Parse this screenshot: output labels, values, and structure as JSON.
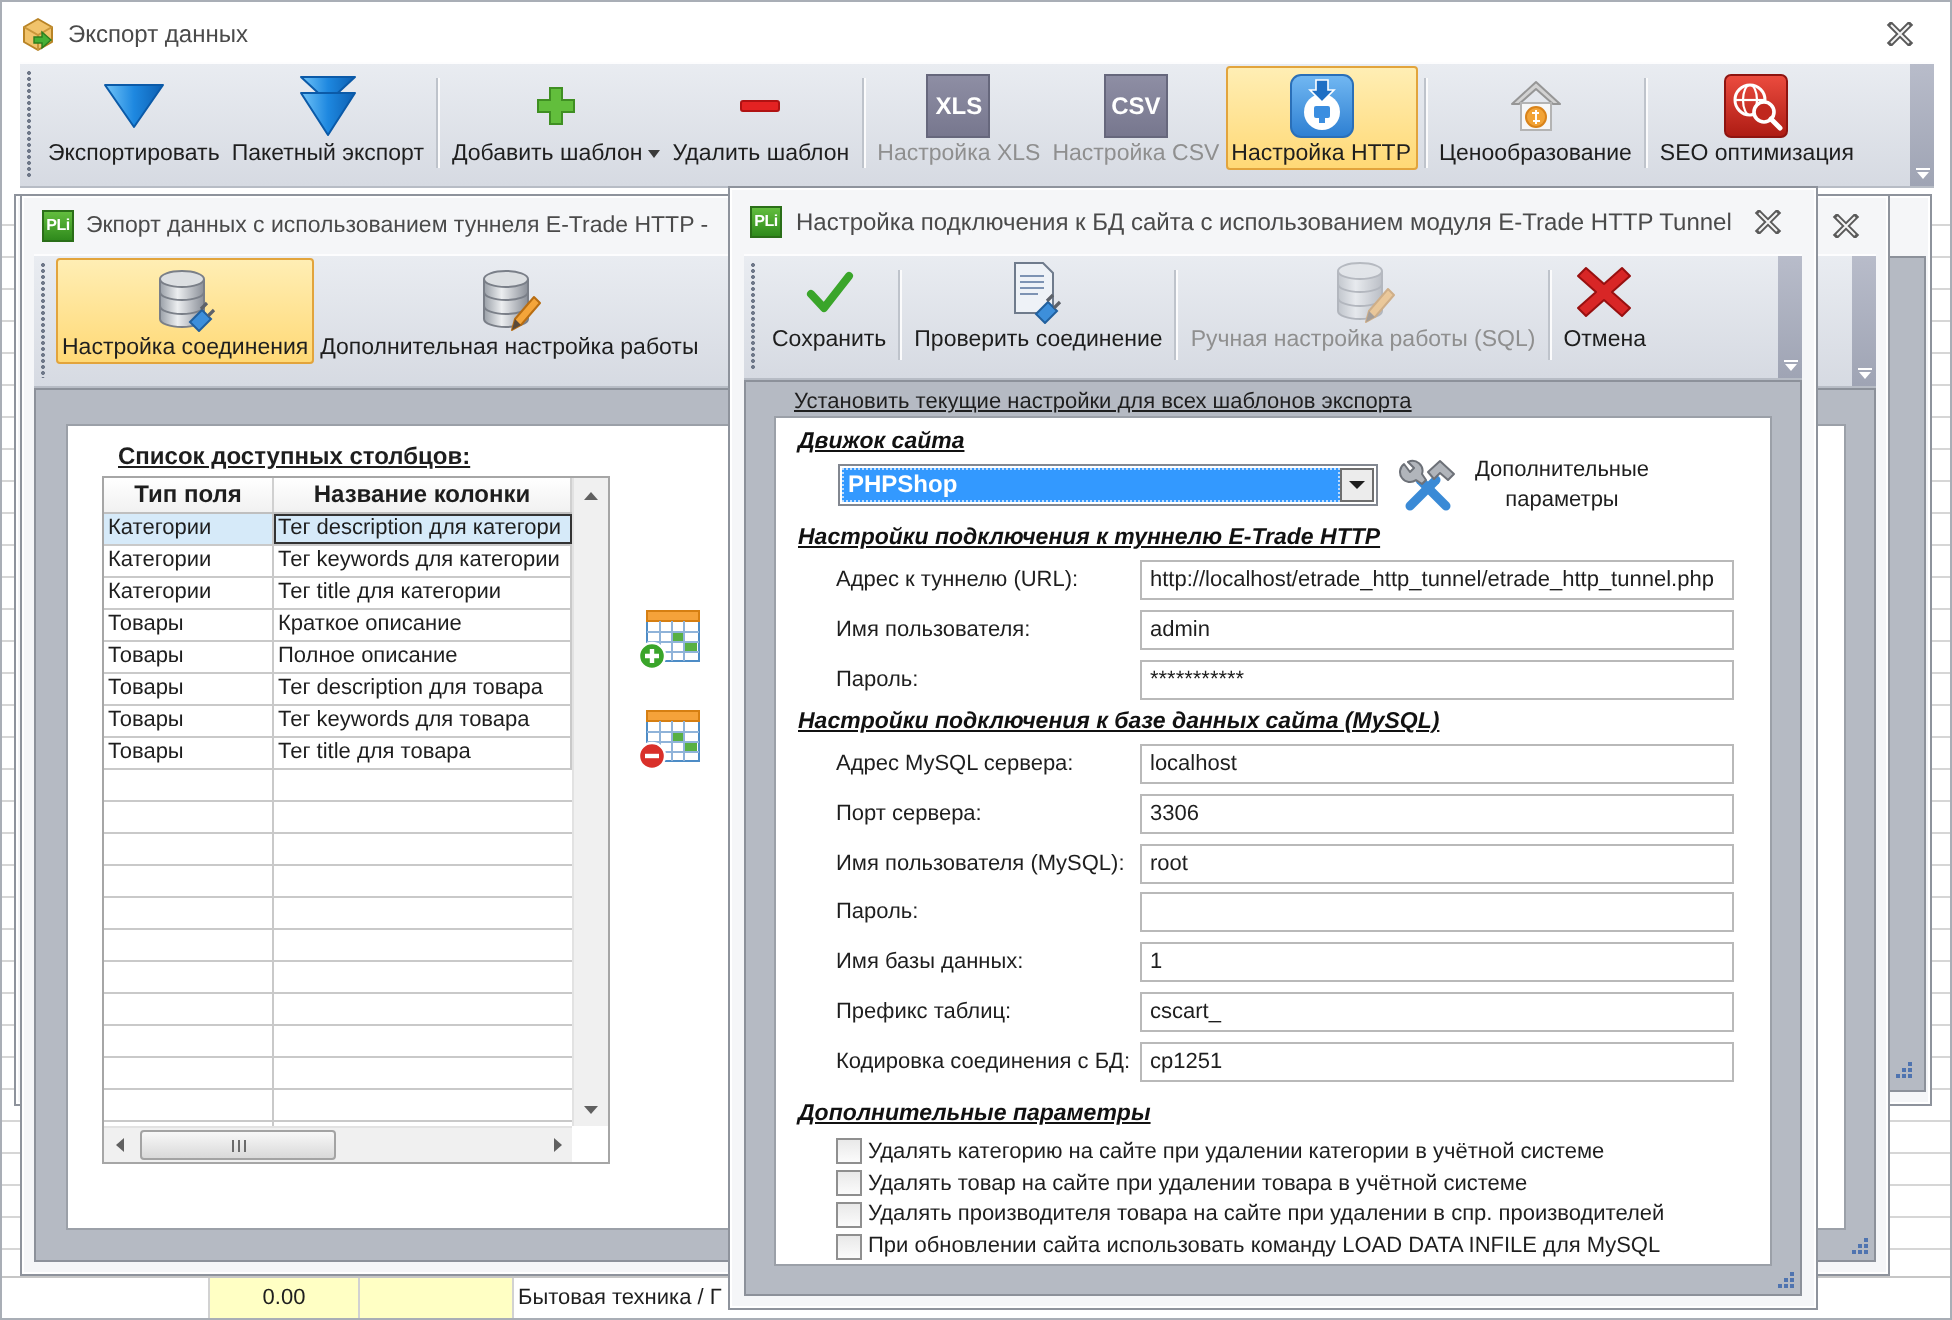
{
  "window": {
    "title": "Экспорт данных"
  },
  "toolbar": {
    "groups": [
      [
        {
          "label": "Экспортировать",
          "selected": false,
          "disabled": false,
          "dropdown": false
        },
        {
          "label": "Пакетный экспорт",
          "selected": false,
          "disabled": false,
          "dropdown": false
        }
      ],
      [
        {
          "label": "Добавить шаблон",
          "selected": false,
          "disabled": false,
          "dropdown": true
        },
        {
          "label": "Удалить шаблон",
          "selected": false,
          "disabled": false,
          "dropdown": false
        }
      ],
      [
        {
          "label": "Настройка XLS",
          "icon_text": "XLS",
          "selected": false,
          "disabled": true,
          "dropdown": false
        },
        {
          "label": "Настройка CSV",
          "icon_text": "CSV",
          "selected": false,
          "disabled": true,
          "dropdown": false
        },
        {
          "label": "Настройка HTTP",
          "selected": true,
          "disabled": false,
          "dropdown": false
        }
      ],
      [
        {
          "label": "Ценообразование",
          "selected": false,
          "disabled": false,
          "dropdown": false
        }
      ],
      [
        {
          "label": "SEO оптимизация",
          "selected": false,
          "disabled": false,
          "dropdown": false
        }
      ]
    ]
  },
  "export_window": {
    "icon_text": "PLi",
    "title": "Экпорт данных с использованием туннеля E-Trade HTTP -",
    "toolbar": {
      "groups": [
        [
          {
            "label": "Настройка соединения",
            "selected": true
          },
          {
            "label": "Дополнительная настройка работы",
            "selected": false
          }
        ]
      ]
    },
    "columns_list": {
      "title": "Список доступных столбцов:",
      "columns": [
        "Тип поля",
        "Название колонки"
      ],
      "rows": [
        {
          "cells": [
            "Категории",
            "Тег description для категори"
          ],
          "selected": true
        },
        {
          "cells": [
            "Категории",
            "Тег keywords для категории"
          ],
          "selected": false
        },
        {
          "cells": [
            "Категории",
            "Тег title для категории"
          ],
          "selected": false
        },
        {
          "cells": [
            "Товары",
            "Краткое описание"
          ],
          "selected": false
        },
        {
          "cells": [
            "Товары",
            "Полное описание"
          ],
          "selected": false
        },
        {
          "cells": [
            "Товары",
            "Тег description для товара"
          ],
          "selected": false
        },
        {
          "cells": [
            "Товары",
            "Тег keywords для товара"
          ],
          "selected": false
        },
        {
          "cells": [
            "Товары",
            "Тег title для товара"
          ],
          "selected": false
        }
      ]
    }
  },
  "dialog": {
    "icon_text": "PLi",
    "title": "Настройка подключения к БД сайта с использованием модуля E-Trade HTTP Tunnel",
    "toolbar": {
      "groups": [
        [
          {
            "label": "Сохранить",
            "disabled": false
          }
        ],
        [
          {
            "label": "Проверить соединение",
            "disabled": false
          }
        ],
        [
          {
            "label": "Ручная настройка работы (SQL)",
            "disabled": true
          }
        ],
        [
          {
            "label": "Отмена",
            "disabled": false
          }
        ]
      ]
    },
    "apply_to_all_link": "Установить текущие настройки для всех шаблонов экспорта",
    "sections": [
      {
        "kind": "engine",
        "heading": "Движок сайта",
        "value": "PHPShop",
        "button": "Дополнительные параметры"
      },
      {
        "kind": "fields",
        "heading": "Настройки подключения к туннелю E-Trade HTTP",
        "fields": [
          {
            "label": "Адрес к туннелю (URL):",
            "value": "http://localhost/etrade_http_tunnel/etrade_http_tunnel.php"
          },
          {
            "label": "Имя пользователя:",
            "value": "admin"
          },
          {
            "label": "Пароль:",
            "value": "***********"
          }
        ]
      },
      {
        "kind": "fields",
        "heading": "Настройки подключения к базе данных сайта (MySQL)",
        "fields": [
          {
            "label": "Адрес MySQL сервера:",
            "value": "localhost"
          },
          {
            "label": "Порт сервера:",
            "value": "3306"
          },
          {
            "label": "Имя пользователя (MySQL):",
            "value": "root"
          },
          {
            "label": "Пароль:"
          },
          {
            "label": "Имя базы данных:",
            "value": "1"
          },
          {
            "label": "Префикс таблиц:",
            "value": "cscart_"
          },
          {
            "label": "Кодировка соединения с БД:",
            "value": "cp1251"
          }
        ]
      },
      {
        "kind": "options",
        "heading": "Дополнительные параметры",
        "options": [
          {
            "label": "Удалять категорию на сайте при удалении категории в учётной системе",
            "checked": false
          },
          {
            "label": "Удалять товар на сайте при удалении товара в учётной системе",
            "checked": false
          },
          {
            "label": "Удалять производителя товара на сайте при удалении в спр. производителей",
            "checked": false
          },
          {
            "label": "При обновлении сайта использовать команду LOAD DATA INFILE для MySQL",
            "checked": false
          }
        ]
      }
    ]
  },
  "sheet": {
    "rows": [
      {
        "column_2": "0.00",
        "column_4": "Бытовая техника / Г"
      }
    ]
  }
}
